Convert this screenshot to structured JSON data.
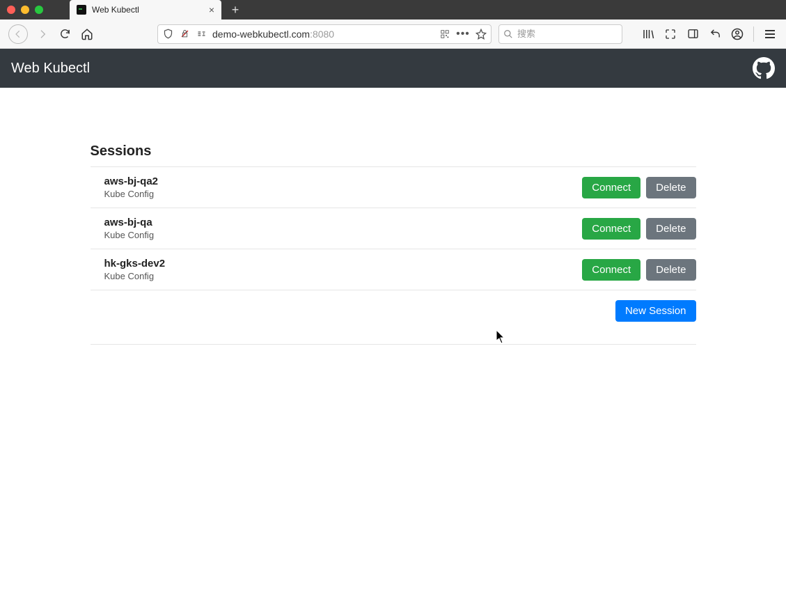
{
  "browser": {
    "tab_title": "Web Kubectl",
    "url_host": "demo-webkubectl.com",
    "url_port": ":8080",
    "search_placeholder": "搜索"
  },
  "header": {
    "title": "Web Kubectl"
  },
  "main": {
    "sessions_title": "Sessions",
    "sessions": [
      {
        "name": "aws-bj-qa2",
        "sub": "Kube Config"
      },
      {
        "name": "aws-bj-qa",
        "sub": "Kube Config"
      },
      {
        "name": "hk-gks-dev2",
        "sub": "Kube Config"
      }
    ],
    "connect_label": "Connect",
    "delete_label": "Delete",
    "new_session_label": "New Session"
  }
}
